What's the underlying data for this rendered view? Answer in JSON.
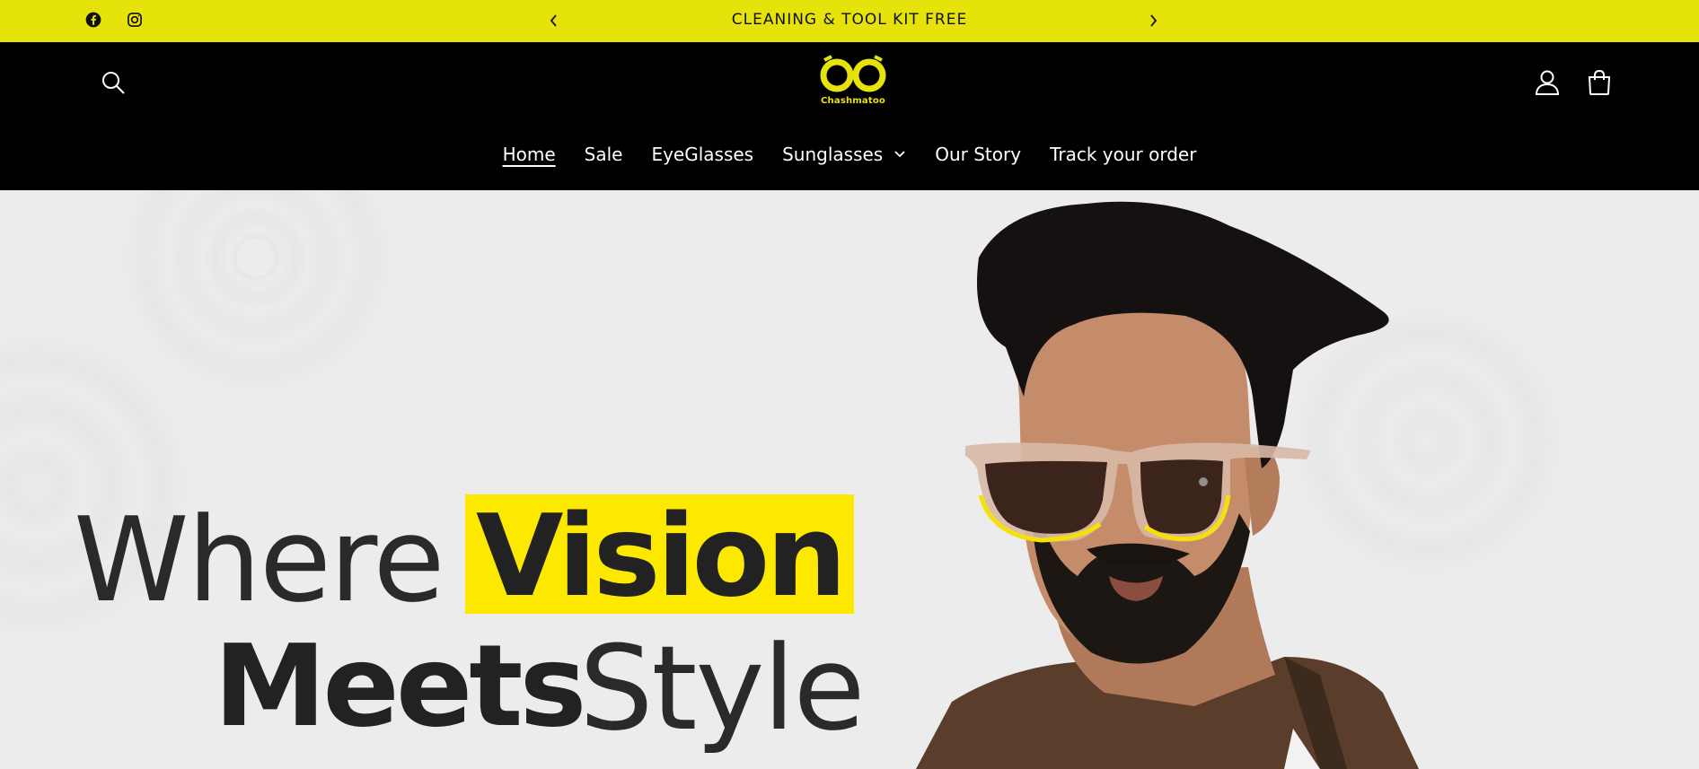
{
  "announcement": {
    "text": "CLEANING & TOOL KIT FREE",
    "social": [
      "facebook-icon",
      "instagram-icon"
    ]
  },
  "brand": {
    "name": "Chashmatoo",
    "accent": "#e6e30b",
    "header_bg": "#000000"
  },
  "nav": {
    "items": [
      {
        "label": "Home",
        "active": true
      },
      {
        "label": "Sale"
      },
      {
        "label": "EyeGlasses"
      },
      {
        "label": "Sunglasses",
        "has_dropdown": true
      },
      {
        "label": "Our Story"
      },
      {
        "label": "Track your order"
      }
    ]
  },
  "hero": {
    "line1_light": "Where",
    "line1_bold": "Vision",
    "line2_bold": "Meets",
    "line2_light": "Style",
    "highlight_color": "#fde800"
  }
}
